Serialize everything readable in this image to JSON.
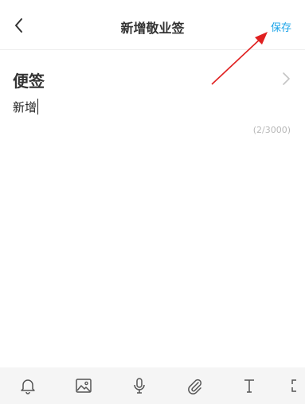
{
  "header": {
    "title": "新增敬业签",
    "save_label": "保存"
  },
  "note": {
    "category_label": "便签",
    "content": "新增",
    "char_count": "(2/3000)"
  },
  "toolbar": {
    "tools": [
      "bell-icon",
      "image-icon",
      "microphone-icon",
      "attachment-icon",
      "text-format-icon",
      "expand-icon"
    ]
  },
  "colors": {
    "accent": "#1aa3e8",
    "annotation_arrow": "#e02020",
    "toolbar_bg": "#f5f5f5"
  }
}
